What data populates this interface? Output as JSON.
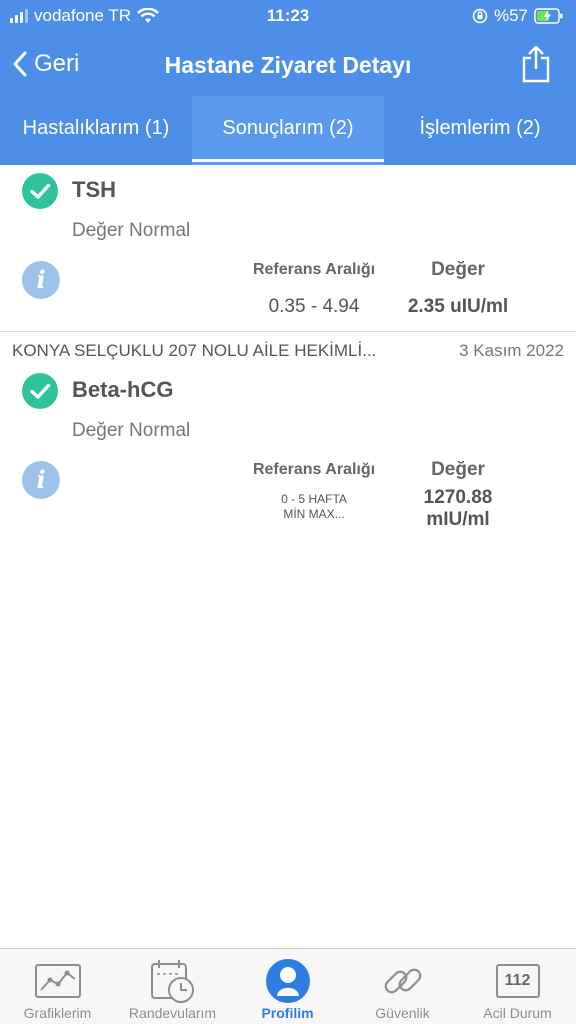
{
  "status_bar": {
    "carrier": "vodafone TR",
    "time": "11:23",
    "battery": "%57"
  },
  "nav": {
    "back_label": "Geri",
    "title": "Hastane Ziyaret Detayı"
  },
  "tabs": [
    {
      "label": "Hastalıklarım (1)"
    },
    {
      "label": "Sonuçlarım (2)"
    },
    {
      "label": "İşlemlerim (2)"
    }
  ],
  "results": [
    {
      "test": "TSH",
      "status": "Değer Normal",
      "ref_header": "Referans Aralığı",
      "value_header": "Değer",
      "ref_value": "0.35 - 4.94",
      "value": "2.35 uIU/ml"
    },
    {
      "clinic": "KONYA SELÇUKLU 207 NOLU AİLE HEKİMLİ...",
      "date": "3 Kasım 2022",
      "test": "Beta-hCG",
      "status": "Değer Normal",
      "ref_header": "Referans Aralığı",
      "value_header": "Değer",
      "ref_value_line1": "0 - 5 HAFTA",
      "ref_value_line2": "MİN MAX...",
      "value_line1": "1270.88",
      "value_line2": "mIU/ml"
    }
  ],
  "tabbar": [
    {
      "label": "Grafiklerim",
      "icon": "chart-icon"
    },
    {
      "label": "Randevularım",
      "icon": "calendar-clock-icon"
    },
    {
      "label": "Profilim",
      "icon": "profile-icon",
      "active": true
    },
    {
      "label": "Güvenlik",
      "icon": "link-icon"
    },
    {
      "label": "Acil Durum",
      "icon": "emergency-112-icon",
      "icon_text": "112"
    }
  ],
  "colors": {
    "header": "#4d8fe8",
    "check": "#2ec39a",
    "info": "#9cc3ea",
    "tab_active": "#2d7de3"
  }
}
